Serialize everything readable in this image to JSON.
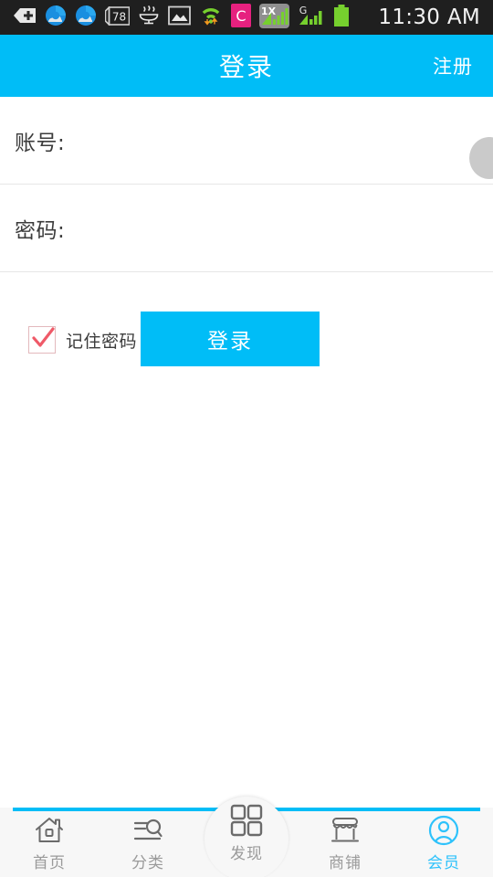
{
  "statusbar": {
    "time": "11:30 AM",
    "icons": [
      {
        "name": "back-plus-icon",
        "label": "back"
      },
      {
        "name": "cloud-sync-icon-1",
        "label": "sync"
      },
      {
        "name": "cloud-sync-icon-2",
        "label": "sync"
      },
      {
        "name": "counter-badge-icon",
        "label": "78"
      },
      {
        "name": "hot-drink-icon",
        "label": "tea"
      },
      {
        "name": "image-icon",
        "label": "image"
      },
      {
        "name": "wifi-icon",
        "label": "wifi"
      },
      {
        "name": "app-c-icon",
        "label": "C"
      },
      {
        "name": "signal-1x-icon",
        "label": "1X"
      },
      {
        "name": "signal-g-icon",
        "label": "G"
      },
      {
        "name": "battery-icon",
        "label": "battery"
      }
    ],
    "badge_count": "78",
    "app_letter": "C",
    "network_1x": "1X",
    "network_g": "G"
  },
  "header": {
    "title": "登录",
    "action_label": "注册",
    "background": "#00bdf7",
    "text_color": "#ffffff"
  },
  "form": {
    "fields": [
      {
        "label": "账号:",
        "value": "",
        "placeholder": ""
      },
      {
        "label": "密码:",
        "value": "",
        "placeholder": ""
      }
    ]
  },
  "options": {
    "remember_label": "记住密码",
    "remember_checked": true,
    "checkbox_check_color": "#ef5a68",
    "login_label": "登录",
    "login_button_color": "#00bdf7"
  },
  "bottomnav": {
    "accent_color": "#00bdf7",
    "active_color": "#2ec2fb",
    "inactive_color": "#9a9a9a",
    "items": [
      {
        "label": "首页",
        "icon": "home-icon",
        "active": false
      },
      {
        "label": "分类",
        "icon": "category-search-icon",
        "active": false
      },
      {
        "label": "发现",
        "icon": "grid-squares-icon",
        "active": false
      },
      {
        "label": "商铺",
        "icon": "storefront-icon",
        "active": false
      },
      {
        "label": "会员",
        "icon": "user-circle-icon",
        "active": true
      }
    ]
  }
}
